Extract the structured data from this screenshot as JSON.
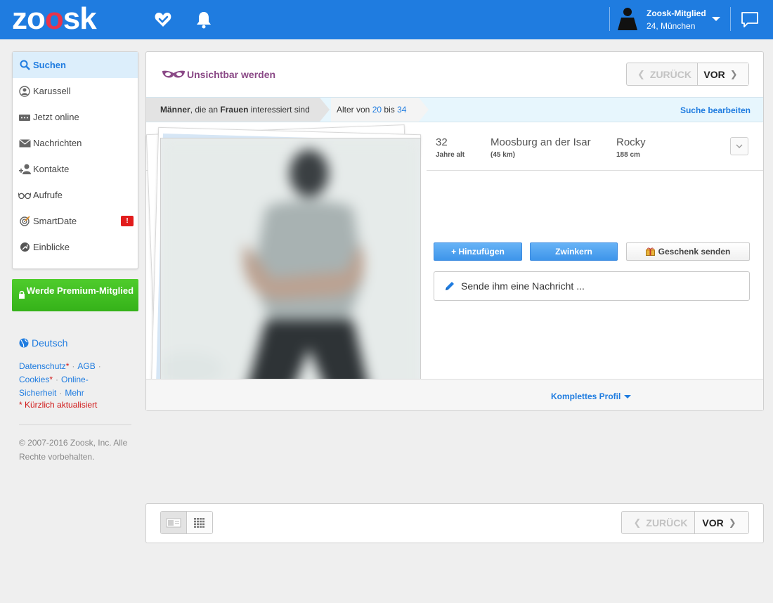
{
  "header": {
    "logo": "zoosk",
    "user": {
      "name": "Zoosk-Mitglied",
      "location": "24, München"
    },
    "icons": [
      "carousel-heart-icon",
      "bell-icon",
      "user-silhouette-icon",
      "chevron-down-icon",
      "chat-bubble-icon"
    ],
    "bg_color": "#1f7ce0"
  },
  "sidebar": {
    "items": [
      {
        "label": "Suchen",
        "icon": "search-icon",
        "active": true
      },
      {
        "label": "Karussell",
        "icon": "carousel-icon"
      },
      {
        "label": "Jetzt online",
        "icon": "online-icon"
      },
      {
        "label": "Nachrichten",
        "icon": "envelope-icon"
      },
      {
        "label": "Kontakte",
        "icon": "contacts-icon"
      },
      {
        "label": "Aufrufe",
        "icon": "glasses-icon"
      },
      {
        "label": "SmartDate",
        "icon": "target-icon",
        "badge": "!"
      },
      {
        "label": "Einblicke",
        "icon": "insights-icon"
      }
    ],
    "premium_button": "Werde Premium-Mitglied",
    "language": "Deutsch",
    "links": {
      "privacy": "Datenschutz",
      "agb": "AGB",
      "cookies": "Cookies",
      "online": "Online-",
      "security": "Sicherheit",
      "more": "Mehr",
      "asterisk": "*",
      "sep": "·"
    },
    "recent_note": "* Kürzlich aktualisiert",
    "copyright": "© 2007-2016 Zoosk, Inc. Alle Rechte vorbehalten."
  },
  "main": {
    "invisible_label": "Unsichtbar werden",
    "pager": {
      "back": "ZURÜCK",
      "forward": "VOR"
    },
    "breadcrumb": {
      "men": "Männer",
      "mid": ", die an ",
      "women": "Frauen",
      "tail": " interessiert sind",
      "age_prefix": "Alter von ",
      "age_from": "20",
      "age_mid": " bis ",
      "age_to": "34",
      "edit": "Suche bearbeiten"
    },
    "profile": {
      "age": "32",
      "age_label": "Jahre alt",
      "location": "Moosburg an der Isar",
      "distance": "(45 km)",
      "name": "Rocky",
      "height": "188 cm"
    },
    "actions": {
      "add": "+ Hinzufügen",
      "wink": "Zwinkern",
      "gift": "Geschenk senden",
      "message_placeholder": "Sende ihm eine Nachricht ..."
    },
    "full_profile": "Komplettes Profil"
  },
  "bottom": {
    "pager": {
      "back": "ZURÜCK",
      "forward": "VOR"
    },
    "view_modes": [
      "single-view-icon",
      "grid-view-icon"
    ]
  }
}
